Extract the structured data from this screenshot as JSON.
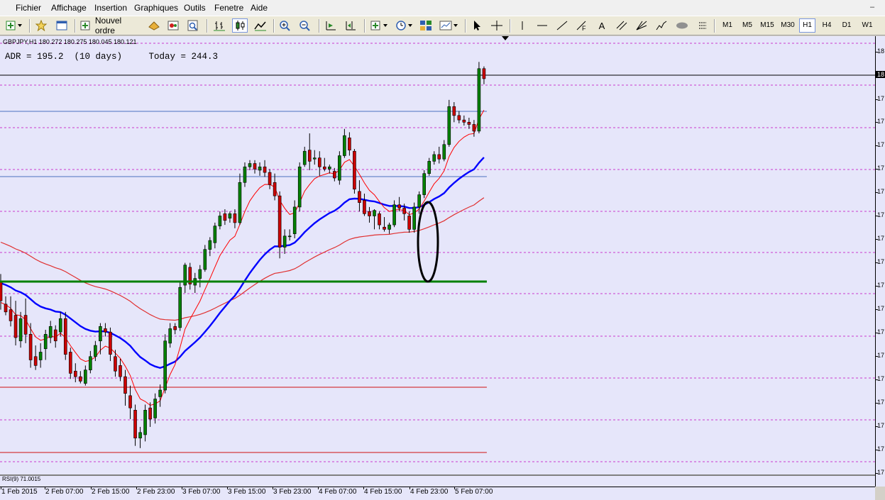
{
  "menu": {
    "items": [
      "Fichier",
      "Affichage",
      "Insertion",
      "Graphiques",
      "Outils",
      "Fenetre",
      "Aide"
    ]
  },
  "toolbar": {
    "new_order_label": "Nouvel ordre",
    "timeframes": [
      "M1",
      "M5",
      "M15",
      "M30",
      "H1",
      "H4",
      "D1",
      "W1"
    ],
    "active_timeframe": "H1",
    "text_tool_label": "A"
  },
  "chart": {
    "symbol_info": "GBPJPY,H1  180.272 180.275 180.045 180.121",
    "adr_text": "ADR = 195.2  (10 days)     Today = 244.3",
    "subwindow_label": "RSI(9) 71.0015",
    "colors": {
      "background": "#e6e6fa",
      "bull": "#008000",
      "bear": "#cc0000",
      "ma_fast": "#ff0000",
      "ma_mid": "#0000ff",
      "ma_slow": "#e03030",
      "support": "#008000",
      "grid": "#c000c0"
    }
  },
  "chart_data": {
    "type": "candlestick",
    "symbol": "GBPJPY",
    "timeframe": "H1",
    "x_labels": [
      "1 Feb 2015",
      "2 Feb 07:00",
      "2 Feb 15:00",
      "2 Feb 23:00",
      "3 Feb 07:00",
      "3 Feb 15:00",
      "3 Feb 23:00",
      "4 Feb 07:00",
      "4 Feb 15:00",
      "4 Feb 23:00",
      "5 Feb 07:00"
    ],
    "y_labels": [
      "18",
      "18",
      "17",
      "17",
      "17",
      "17",
      "17",
      "17",
      "17",
      "17",
      "17",
      "17",
      "17",
      "17",
      "17",
      "17",
      "17",
      "17",
      "17"
    ],
    "candles": [
      {
        "o": 64.5,
        "h": 65.2,
        "l": 62.0,
        "c": 62.8
      },
      {
        "o": 62.5,
        "h": 63.2,
        "l": 61.5,
        "c": 61.8
      },
      {
        "o": 62.0,
        "h": 63.2,
        "l": 60.5,
        "c": 61.0
      },
      {
        "o": 61.5,
        "h": 62.8,
        "l": 58.8,
        "c": 59.5
      },
      {
        "o": 59.2,
        "h": 61.8,
        "l": 58.6,
        "c": 61.2
      },
      {
        "o": 61.5,
        "h": 63.0,
        "l": 59.0,
        "c": 59.8
      },
      {
        "o": 59.8,
        "h": 60.8,
        "l": 56.8,
        "c": 57.5
      },
      {
        "o": 57.8,
        "h": 58.8,
        "l": 56.6,
        "c": 57.0
      },
      {
        "o": 57.5,
        "h": 59.0,
        "l": 56.8,
        "c": 58.2
      },
      {
        "o": 58.5,
        "h": 60.2,
        "l": 57.5,
        "c": 59.8
      },
      {
        "o": 59.5,
        "h": 61.0,
        "l": 59.0,
        "c": 60.5
      },
      {
        "o": 60.2,
        "h": 60.6,
        "l": 58.6,
        "c": 59.2
      },
      {
        "o": 60.0,
        "h": 61.8,
        "l": 59.6,
        "c": 61.2
      },
      {
        "o": 61.2,
        "h": 61.8,
        "l": 57.5,
        "c": 58.0
      },
      {
        "o": 58.2,
        "h": 58.6,
        "l": 55.8,
        "c": 56.3
      },
      {
        "o": 56.5,
        "h": 57.2,
        "l": 55.5,
        "c": 56.0
      },
      {
        "o": 56.0,
        "h": 56.5,
        "l": 55.4,
        "c": 55.6
      },
      {
        "o": 55.4,
        "h": 57.0,
        "l": 55.2,
        "c": 56.6
      },
      {
        "o": 56.6,
        "h": 58.3,
        "l": 56.3,
        "c": 57.8
      },
      {
        "o": 57.8,
        "h": 59.2,
        "l": 57.4,
        "c": 58.8
      },
      {
        "o": 59.2,
        "h": 60.8,
        "l": 58.0,
        "c": 60.5
      },
      {
        "o": 60.3,
        "h": 60.8,
        "l": 59.6,
        "c": 60.0
      },
      {
        "o": 60.0,
        "h": 60.4,
        "l": 57.4,
        "c": 58.0
      },
      {
        "o": 57.8,
        "h": 58.4,
        "l": 56.0,
        "c": 56.5
      },
      {
        "o": 57.0,
        "h": 57.6,
        "l": 55.6,
        "c": 56.0
      },
      {
        "o": 56.0,
        "h": 56.6,
        "l": 53.4,
        "c": 54.5
      },
      {
        "o": 54.3,
        "h": 55.2,
        "l": 52.2,
        "c": 53.2
      },
      {
        "o": 53.0,
        "h": 53.5,
        "l": 49.8,
        "c": 50.5
      },
      {
        "o": 50.5,
        "h": 51.5,
        "l": 49.6,
        "c": 51.0
      },
      {
        "o": 50.8,
        "h": 53.5,
        "l": 50.2,
        "c": 53.0
      },
      {
        "o": 53.2,
        "h": 53.7,
        "l": 51.5,
        "c": 52.2
      },
      {
        "o": 52.3,
        "h": 54.5,
        "l": 51.8,
        "c": 54.0
      },
      {
        "o": 54.2,
        "h": 55.3,
        "l": 53.3,
        "c": 54.8
      },
      {
        "o": 54.8,
        "h": 59.8,
        "l": 54.5,
        "c": 59.2
      },
      {
        "o": 59.0,
        "h": 60.8,
        "l": 58.6,
        "c": 60.3
      },
      {
        "o": 60.5,
        "h": 60.8,
        "l": 59.8,
        "c": 60.2
      },
      {
        "o": 60.4,
        "h": 64.5,
        "l": 60.1,
        "c": 64.0
      },
      {
        "o": 64.2,
        "h": 66.2,
        "l": 63.5,
        "c": 66.0
      },
      {
        "o": 65.8,
        "h": 66.2,
        "l": 63.8,
        "c": 64.3
      },
      {
        "o": 64.2,
        "h": 65.3,
        "l": 63.5,
        "c": 64.8
      },
      {
        "o": 64.8,
        "h": 66.0,
        "l": 64.0,
        "c": 65.6
      },
      {
        "o": 65.6,
        "h": 67.8,
        "l": 65.4,
        "c": 67.4
      },
      {
        "o": 67.4,
        "h": 68.5,
        "l": 66.8,
        "c": 68.2
      },
      {
        "o": 68.0,
        "h": 69.8,
        "l": 67.5,
        "c": 69.5
      },
      {
        "o": 69.5,
        "h": 70.8,
        "l": 69.2,
        "c": 70.4
      },
      {
        "o": 70.6,
        "h": 71.0,
        "l": 69.6,
        "c": 70.0
      },
      {
        "o": 70.2,
        "h": 70.8,
        "l": 69.8,
        "c": 70.6
      },
      {
        "o": 70.6,
        "h": 71.0,
        "l": 69.3,
        "c": 69.8
      },
      {
        "o": 69.8,
        "h": 74.2,
        "l": 69.6,
        "c": 73.4
      },
      {
        "o": 73.4,
        "h": 75.2,
        "l": 73.0,
        "c": 74.8
      },
      {
        "o": 74.8,
        "h": 75.4,
        "l": 74.5,
        "c": 75.1
      },
      {
        "o": 75.1,
        "h": 75.4,
        "l": 74.2,
        "c": 74.6
      },
      {
        "o": 74.5,
        "h": 75.2,
        "l": 74.0,
        "c": 74.8
      },
      {
        "o": 74.8,
        "h": 75.4,
        "l": 73.9,
        "c": 74.3
      },
      {
        "o": 74.3,
        "h": 74.6,
        "l": 72.8,
        "c": 73.2
      },
      {
        "o": 73.4,
        "h": 74.2,
        "l": 71.8,
        "c": 72.2
      },
      {
        "o": 72.2,
        "h": 72.6,
        "l": 66.6,
        "c": 67.6
      },
      {
        "o": 67.6,
        "h": 69.2,
        "l": 67.0,
        "c": 68.6
      },
      {
        "o": 68.6,
        "h": 69.2,
        "l": 68.2,
        "c": 68.6
      },
      {
        "o": 68.8,
        "h": 71.8,
        "l": 68.4,
        "c": 71.2
      },
      {
        "o": 71.2,
        "h": 75.2,
        "l": 70.8,
        "c": 74.8
      },
      {
        "o": 75.0,
        "h": 76.6,
        "l": 74.8,
        "c": 76.2
      },
      {
        "o": 76.3,
        "h": 77.8,
        "l": 74.5,
        "c": 75.3
      },
      {
        "o": 75.5,
        "h": 76.3,
        "l": 75.0,
        "c": 75.6
      },
      {
        "o": 75.6,
        "h": 76.2,
        "l": 74.0,
        "c": 74.8
      },
      {
        "o": 74.8,
        "h": 75.6,
        "l": 74.4,
        "c": 74.6
      },
      {
        "o": 74.6,
        "h": 75.0,
        "l": 74.2,
        "c": 74.8
      },
      {
        "o": 74.4,
        "h": 74.7,
        "l": 73.5,
        "c": 73.8
      },
      {
        "o": 73.6,
        "h": 76.2,
        "l": 73.2,
        "c": 75.8
      },
      {
        "o": 75.8,
        "h": 78.2,
        "l": 75.6,
        "c": 77.6
      },
      {
        "o": 77.4,
        "h": 77.9,
        "l": 75.8,
        "c": 76.3
      },
      {
        "o": 76.2,
        "h": 76.4,
        "l": 72.4,
        "c": 72.8
      },
      {
        "o": 72.6,
        "h": 73.6,
        "l": 70.8,
        "c": 71.6
      },
      {
        "o": 71.8,
        "h": 72.4,
        "l": 70.4,
        "c": 70.6
      },
      {
        "o": 70.8,
        "h": 71.2,
        "l": 69.8,
        "c": 70.4
      },
      {
        "o": 70.4,
        "h": 71.0,
        "l": 69.2,
        "c": 70.9
      },
      {
        "o": 70.6,
        "h": 70.8,
        "l": 69.2,
        "c": 69.6
      },
      {
        "o": 69.4,
        "h": 70.3,
        "l": 69.0,
        "c": 69.2
      },
      {
        "o": 69.2,
        "h": 69.8,
        "l": 68.8,
        "c": 69.6
      },
      {
        "o": 69.6,
        "h": 71.8,
        "l": 69.4,
        "c": 71.4
      },
      {
        "o": 71.4,
        "h": 72.1,
        "l": 70.8,
        "c": 71.1
      },
      {
        "o": 71.1,
        "h": 71.5,
        "l": 70.0,
        "c": 70.6
      },
      {
        "o": 70.4,
        "h": 70.8,
        "l": 68.9,
        "c": 69.2
      },
      {
        "o": 69.2,
        "h": 71.6,
        "l": 68.9,
        "c": 71.2
      },
      {
        "o": 71.2,
        "h": 72.6,
        "l": 70.6,
        "c": 72.3
      },
      {
        "o": 72.3,
        "h": 74.5,
        "l": 72.0,
        "c": 74.2
      },
      {
        "o": 74.2,
        "h": 75.6,
        "l": 74.0,
        "c": 75.3
      },
      {
        "o": 75.3,
        "h": 76.2,
        "l": 75.0,
        "c": 75.9
      },
      {
        "o": 75.9,
        "h": 76.6,
        "l": 75.1,
        "c": 75.5
      },
      {
        "o": 75.5,
        "h": 77.2,
        "l": 75.3,
        "c": 76.8
      },
      {
        "o": 76.8,
        "h": 80.8,
        "l": 76.6,
        "c": 80.2
      },
      {
        "o": 80.2,
        "h": 80.6,
        "l": 78.8,
        "c": 79.4
      },
      {
        "o": 79.4,
        "h": 79.8,
        "l": 78.7,
        "c": 79.0
      },
      {
        "o": 79.0,
        "h": 79.4,
        "l": 78.5,
        "c": 78.8
      },
      {
        "o": 78.8,
        "h": 79.2,
        "l": 78.2,
        "c": 78.6
      },
      {
        "o": 78.6,
        "h": 79.0,
        "l": 77.5,
        "c": 78.0
      },
      {
        "o": 78.0,
        "h": 84.2,
        "l": 77.8,
        "c": 83.6
      },
      {
        "o": 83.6,
        "h": 83.8,
        "l": 82.2,
        "c": 82.7
      }
    ]
  }
}
